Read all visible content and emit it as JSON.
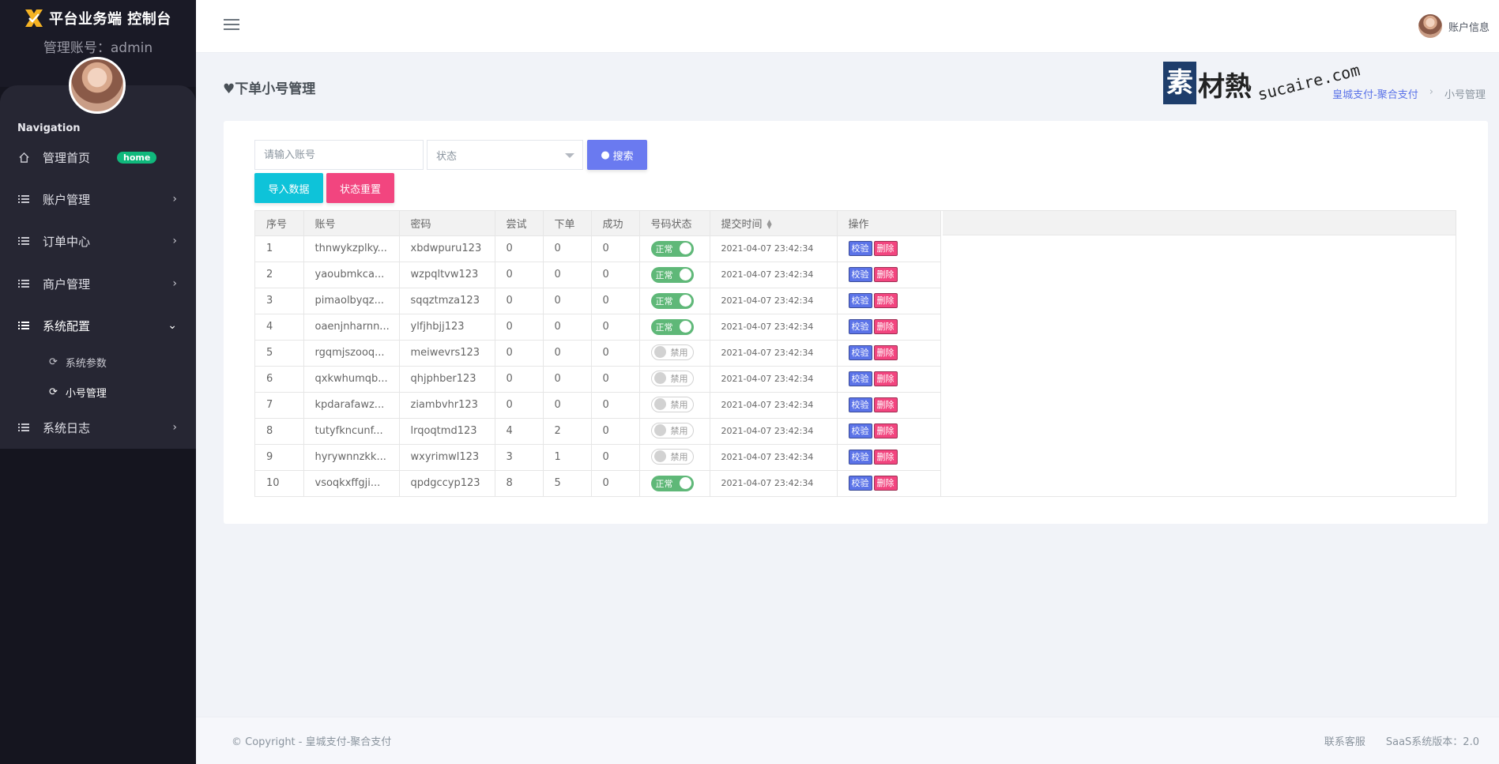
{
  "app": {
    "title": "平台业务端 控制台",
    "account_label": "管理账号：admin"
  },
  "sidebar": {
    "caption": "Navigation",
    "items": [
      {
        "label": "管理首页",
        "icon": "home-icon",
        "badge": "home"
      },
      {
        "label": "账户管理",
        "icon": "list-icon"
      },
      {
        "label": "订单中心",
        "icon": "list-icon"
      },
      {
        "label": "商户管理",
        "icon": "list-icon"
      },
      {
        "label": "系统配置",
        "icon": "list-icon",
        "expanded": true
      },
      {
        "label": "系统日志",
        "icon": "list-icon"
      }
    ],
    "subitems": [
      {
        "label": "系统参数",
        "icon": "refresh-icon"
      },
      {
        "label": "小号管理",
        "icon": "refresh-icon",
        "active": true
      }
    ]
  },
  "topbar": {
    "user_label": "账户信息"
  },
  "page": {
    "title": "♥下单小号管理",
    "breadcrumb": [
      "皇城支付-聚合支付",
      "小号管理"
    ],
    "watermark": {
      "box": "素",
      "text": "材熱",
      "domain": "sucaire.com"
    }
  },
  "filters": {
    "account_placeholder": "请输入账号",
    "status_placeholder": "状态",
    "search_label": "搜索",
    "import_label": "导入数据",
    "reset_label": "状态重置"
  },
  "table": {
    "headers": [
      "序号",
      "账号",
      "密码",
      "尝试",
      "下单",
      "成功",
      "号码状态",
      "提交时间",
      "操作"
    ],
    "status_on": "正常",
    "status_off": "禁用",
    "action_check": "校验",
    "action_delete": "删除",
    "rows": [
      {
        "no": "1",
        "account": "thnwykzplky...",
        "password": "xbdwpuru123",
        "tries": "0",
        "orders": "0",
        "success": "0",
        "enabled": true,
        "time": "2021-04-07 23:42:34"
      },
      {
        "no": "2",
        "account": "yaoubmkca...",
        "password": "wzpqltvw123",
        "tries": "0",
        "orders": "0",
        "success": "0",
        "enabled": true,
        "time": "2021-04-07 23:42:34"
      },
      {
        "no": "3",
        "account": "pimaolbyqz...",
        "password": "sqqztmza123",
        "tries": "0",
        "orders": "0",
        "success": "0",
        "enabled": true,
        "time": "2021-04-07 23:42:34"
      },
      {
        "no": "4",
        "account": "oaenjnharnn...",
        "password": "ylfjhbjj123",
        "tries": "0",
        "orders": "0",
        "success": "0",
        "enabled": true,
        "time": "2021-04-07 23:42:34"
      },
      {
        "no": "5",
        "account": "rgqmjszooq...",
        "password": "meiwevrs123",
        "tries": "0",
        "orders": "0",
        "success": "0",
        "enabled": false,
        "time": "2021-04-07 23:42:34"
      },
      {
        "no": "6",
        "account": "qxkwhumqb...",
        "password": "qhjphber123",
        "tries": "0",
        "orders": "0",
        "success": "0",
        "enabled": false,
        "time": "2021-04-07 23:42:34"
      },
      {
        "no": "7",
        "account": "kpdarafawz...",
        "password": "ziambvhr123",
        "tries": "0",
        "orders": "0",
        "success": "0",
        "enabled": false,
        "time": "2021-04-07 23:42:34"
      },
      {
        "no": "8",
        "account": "tutyfkncunf...",
        "password": "lrqoqtmd123",
        "tries": "4",
        "orders": "2",
        "success": "0",
        "enabled": false,
        "time": "2021-04-07 23:42:34"
      },
      {
        "no": "9",
        "account": "hyrywnnzkk...",
        "password": "wxyrimwl123",
        "tries": "3",
        "orders": "1",
        "success": "0",
        "enabled": false,
        "time": "2021-04-07 23:42:34"
      },
      {
        "no": "10",
        "account": "vsoqkxffgji...",
        "password": "qpdgccyp123",
        "tries": "8",
        "orders": "5",
        "success": "0",
        "enabled": true,
        "time": "2021-04-07 23:42:34"
      }
    ]
  },
  "footer": {
    "copyright_prefix": "© Copyright - ",
    "copyright_link": "皇城支付-聚合支付",
    "support": "联系客服",
    "version": "SaaS系统版本：2.0"
  },
  "colors": {
    "sidebar_bg": "#15151f",
    "primary": "#5b73e8",
    "cyan": "#0ec3d9",
    "pink": "#f2457f",
    "switch_on": "#5fb878",
    "badge_green": "#10b87c"
  }
}
